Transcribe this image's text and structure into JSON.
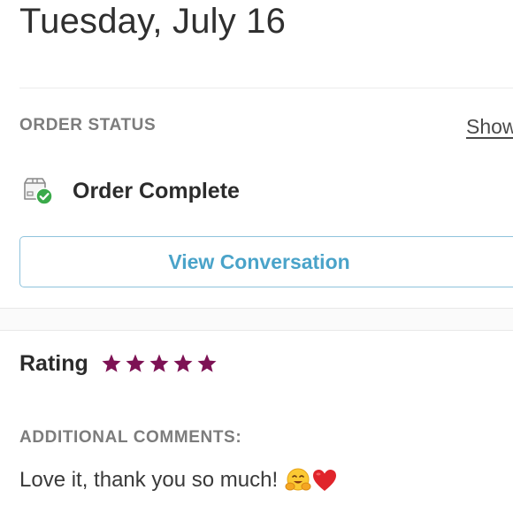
{
  "header": {
    "date": "Tuesday, July 16"
  },
  "order_status": {
    "section_label": "ORDER STATUS",
    "show_link": "Show",
    "status_icon": "package-check-icon",
    "status_text": "Order Complete",
    "view_button_label": "View Conversation"
  },
  "rating": {
    "label": "Rating",
    "stars": 5,
    "max_stars": 5,
    "star_color": "#7d1254"
  },
  "comments": {
    "section_label": "ADDITIONAL COMMENTS:",
    "text": "Love it, thank you so much!",
    "emojis": [
      "hugging-face-emoji",
      "red-heart-emoji"
    ]
  },
  "colors": {
    "accent": "#4aa3c9",
    "button_border": "#8fc3dc",
    "check_green": "#3aaa4a",
    "label_gray": "#7c7c7c"
  }
}
